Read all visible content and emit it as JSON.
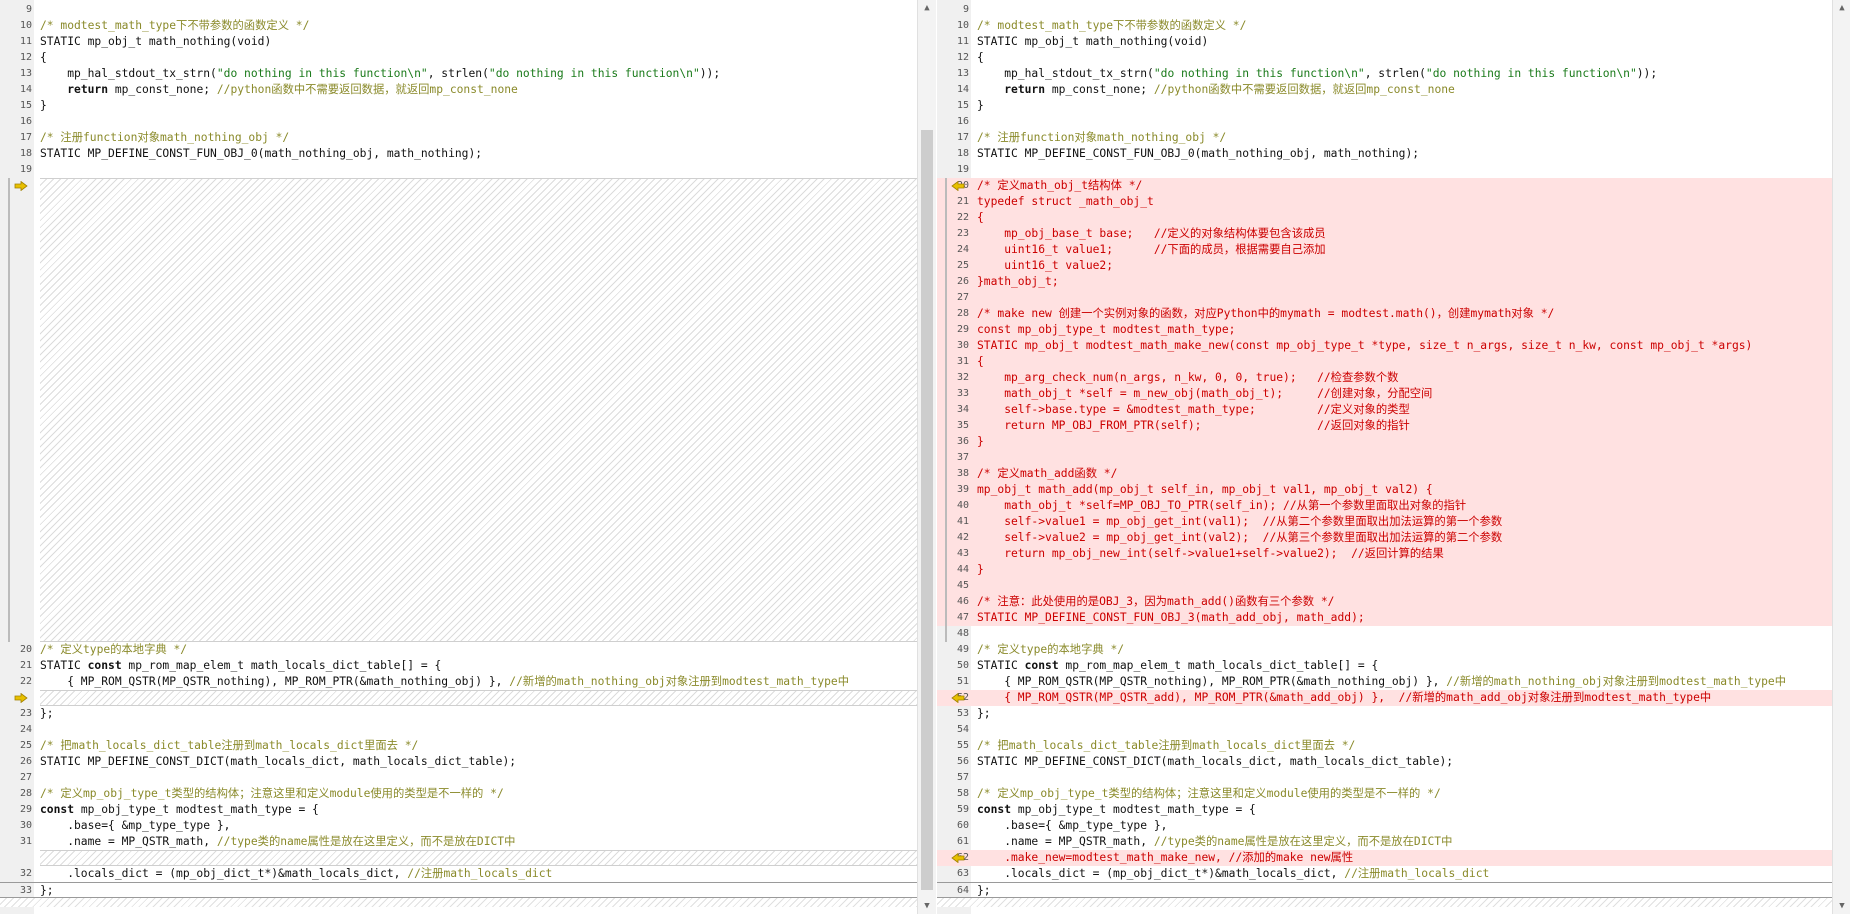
{
  "left": {
    "lines": [
      {
        "n": "9",
        "t": ""
      },
      {
        "n": "10",
        "t": "/* modtest_math_type下不带参数的函数定义 */",
        "cls": "c"
      },
      {
        "n": "11",
        "t": "STATIC mp_obj_t math_nothing(void)"
      },
      {
        "n": "12",
        "t": "{"
      },
      {
        "n": "13",
        "t": "    mp_hal_stdout_tx_strn(\"do nothing in this function\\n\", strlen(\"do nothing in this function\\n\"));"
      },
      {
        "n": "14",
        "t": "    return mp_const_none; //python函数中不需要返回数据，就返回mp_const_none"
      },
      {
        "n": "15",
        "t": "}"
      },
      {
        "n": "16",
        "t": ""
      },
      {
        "n": "17",
        "t": "/* 注册function对象math_nothing_obj */",
        "cls": "c"
      },
      {
        "n": "18",
        "t": "STATIC MP_DEFINE_CONST_FUN_OBJ_0(math_nothing_obj, math_nothing);"
      },
      {
        "n": "19",
        "t": ""
      }
    ],
    "lines2": [
      {
        "n": "20",
        "t": "/* 定义type的本地字典 */",
        "cls": "c"
      },
      {
        "n": "21",
        "t": "STATIC const mp_rom_map_elem_t math_locals_dict_table[] = {"
      },
      {
        "n": "22",
        "t": "    { MP_ROM_QSTR(MP_QSTR_nothing), MP_ROM_PTR(&math_nothing_obj) }, //新增的math_nothing_obj对象注册到modtest_math_type中"
      }
    ],
    "lines3": [
      {
        "n": "23",
        "t": "};"
      },
      {
        "n": "24",
        "t": ""
      },
      {
        "n": "25",
        "t": "/* 把math_locals_dict_table注册到math_locals_dict里面去 */",
        "cls": "c"
      },
      {
        "n": "26",
        "t": "STATIC MP_DEFINE_CONST_DICT(math_locals_dict, math_locals_dict_table);"
      },
      {
        "n": "27",
        "t": ""
      },
      {
        "n": "28",
        "t": "/* 定义mp_obj_type_t类型的结构体；注意这里和定义module使用的类型是不一样的 */",
        "cls": "c"
      },
      {
        "n": "29",
        "t": "const mp_obj_type_t modtest_math_type = {"
      },
      {
        "n": "30",
        "t": "    .base={ &mp_type_type },"
      },
      {
        "n": "31",
        "t": "    .name = MP_QSTR_math, //type类的name属性是放在这里定义，而不是放在DICT中"
      }
    ],
    "lines4": [
      {
        "n": "32",
        "t": "    .locals_dict = (mp_obj_dict_t*)&math_locals_dict, //注册math_locals_dict"
      },
      {
        "n": "33",
        "t": "};"
      }
    ]
  },
  "right": {
    "lines": [
      {
        "n": "9",
        "t": ""
      },
      {
        "n": "10",
        "t": "/* modtest_math_type下不带参数的函数定义 */",
        "cls": "c"
      },
      {
        "n": "11",
        "t": "STATIC mp_obj_t math_nothing(void)"
      },
      {
        "n": "12",
        "t": "{"
      },
      {
        "n": "13",
        "t": "    mp_hal_stdout_tx_strn(\"do nothing in this function\\n\", strlen(\"do nothing in this function\\n\"));"
      },
      {
        "n": "14",
        "t": "    return mp_const_none; //python函数中不需要返回数据，就返回mp_const_none"
      },
      {
        "n": "15",
        "t": "}"
      },
      {
        "n": "16",
        "t": ""
      },
      {
        "n": "17",
        "t": "/* 注册function对象math_nothing_obj */",
        "cls": "c"
      },
      {
        "n": "18",
        "t": "STATIC MP_DEFINE_CONST_FUN_OBJ_0(math_nothing_obj, math_nothing);"
      },
      {
        "n": "19",
        "t": ""
      },
      {
        "n": "20",
        "t": "/* 定义math_obj_t结构体 */",
        "diff": true
      },
      {
        "n": "21",
        "t": "typedef struct _math_obj_t",
        "diff": true
      },
      {
        "n": "22",
        "t": "{",
        "diff": true
      },
      {
        "n": "23",
        "t": "    mp_obj_base_t base;   //定义的对象结构体要包含该成员",
        "diff": true
      },
      {
        "n": "24",
        "t": "    uint16_t value1;      //下面的成员，根据需要自己添加",
        "diff": true
      },
      {
        "n": "25",
        "t": "    uint16_t value2;",
        "diff": true
      },
      {
        "n": "26",
        "t": "}math_obj_t;",
        "diff": true
      },
      {
        "n": "27",
        "t": "",
        "diff": true
      },
      {
        "n": "28",
        "t": "/* make new 创建一个实例对象的函数，对应Python中的mymath = modtest.math()，创建mymath对象 */",
        "diff": true
      },
      {
        "n": "29",
        "t": "const mp_obj_type_t modtest_math_type;",
        "diff": true
      },
      {
        "n": "30",
        "t": "STATIC mp_obj_t modtest_math_make_new(const mp_obj_type_t *type, size_t n_args, size_t n_kw, const mp_obj_t *args)",
        "diff": true
      },
      {
        "n": "31",
        "t": "{",
        "diff": true
      },
      {
        "n": "32",
        "t": "    mp_arg_check_num(n_args, n_kw, 0, 0, true);   //检查参数个数",
        "diff": true
      },
      {
        "n": "33",
        "t": "    math_obj_t *self = m_new_obj(math_obj_t);     //创建对象，分配空间",
        "diff": true
      },
      {
        "n": "34",
        "t": "    self->base.type = &modtest_math_type;         //定义对象的类型",
        "diff": true
      },
      {
        "n": "35",
        "t": "    return MP_OBJ_FROM_PTR(self);                 //返回对象的指针",
        "diff": true
      },
      {
        "n": "36",
        "t": "}",
        "diff": true
      },
      {
        "n": "37",
        "t": "",
        "diff": true
      },
      {
        "n": "38",
        "t": "/* 定义math_add函数 */",
        "diff": true
      },
      {
        "n": "39",
        "t": "mp_obj_t math_add(mp_obj_t self_in, mp_obj_t val1, mp_obj_t val2) {",
        "diff": true
      },
      {
        "n": "40",
        "t": "    math_obj_t *self=MP_OBJ_TO_PTR(self_in); //从第一个参数里面取出对象的指针",
        "diff": true
      },
      {
        "n": "41",
        "t": "    self->value1 = mp_obj_get_int(val1);  //从第二个参数里面取出加法运算的第一个参数",
        "diff": true
      },
      {
        "n": "42",
        "t": "    self->value2 = mp_obj_get_int(val2);  //从第三个参数里面取出加法运算的第二个参数",
        "diff": true
      },
      {
        "n": "43",
        "t": "    return mp_obj_new_int(self->value1+self->value2);  //返回计算的结果",
        "diff": true
      },
      {
        "n": "44",
        "t": "}",
        "diff": true
      },
      {
        "n": "45",
        "t": "",
        "diff": true
      },
      {
        "n": "46",
        "t": "/* 注意：此处使用的是OBJ_3，因为math_add()函数有三个参数 */",
        "diff": true
      },
      {
        "n": "47",
        "t": "STATIC MP_DEFINE_CONST_FUN_OBJ_3(math_add_obj, math_add);",
        "diff": true
      },
      {
        "n": "48",
        "t": ""
      },
      {
        "n": "49",
        "t": "/* 定义type的本地字典 */",
        "cls": "c"
      },
      {
        "n": "50",
        "t": "STATIC const mp_rom_map_elem_t math_locals_dict_table[] = {"
      },
      {
        "n": "51",
        "t": "    { MP_ROM_QSTR(MP_QSTR_nothing), MP_ROM_PTR(&math_nothing_obj) }, //新增的math_nothing_obj对象注册到modtest_math_type中"
      },
      {
        "n": "52",
        "t": "    { MP_ROM_QSTR(MP_QSTR_add), MP_ROM_PTR(&math_add_obj) },  //新增的math_add_obj对象注册到modtest_math_type中",
        "diff": true
      },
      {
        "n": "53",
        "t": "};"
      },
      {
        "n": "54",
        "t": ""
      },
      {
        "n": "55",
        "t": "/* 把math_locals_dict_table注册到math_locals_dict里面去 */",
        "cls": "c"
      },
      {
        "n": "56",
        "t": "STATIC MP_DEFINE_CONST_DICT(math_locals_dict, math_locals_dict_table);"
      },
      {
        "n": "57",
        "t": ""
      },
      {
        "n": "58",
        "t": "/* 定义mp_obj_type_t类型的结构体；注意这里和定义module使用的类型是不一样的 */",
        "cls": "c"
      },
      {
        "n": "59",
        "t": "const mp_obj_type_t modtest_math_type = {"
      },
      {
        "n": "60",
        "t": "    .base={ &mp_type_type },"
      },
      {
        "n": "61",
        "t": "    .name = MP_QSTR_math, //type类的name属性是放在这里定义，而不是放在DICT中"
      },
      {
        "n": "62",
        "t": "    .make_new=modtest_math_make_new, //添加的make new属性",
        "diff": true
      },
      {
        "n": "63",
        "t": "    .locals_dict = (mp_obj_dict_t*)&math_locals_dict, //注册math_locals_dict"
      },
      {
        "n": "64",
        "t": "};"
      }
    ]
  },
  "icons": {
    "diff_marker": "arrow-right-icon",
    "scroll_up": "arrow-up-icon",
    "scroll_down": "arrow-down-icon"
  },
  "colors": {
    "diff_bg": "#ffe1e1",
    "diff_text": "#cc0000",
    "comment": "#8a8a2a",
    "string": "#1a7a1a",
    "marker": "#e8c000"
  }
}
